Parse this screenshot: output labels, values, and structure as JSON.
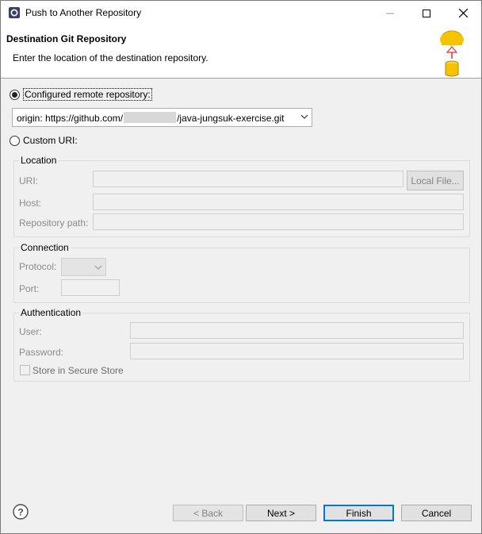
{
  "window": {
    "title": "Push to Another Repository"
  },
  "banner": {
    "title": "Destination Git Repository",
    "description": "Enter the location of the destination repository."
  },
  "configured": {
    "label": "Configured remote repository:",
    "selected": true,
    "combo_prefix": "origin: https://github.com/",
    "combo_suffix": "/java-jungsuk-exercise.git"
  },
  "custom": {
    "label": "Custom URI:",
    "selected": false
  },
  "location": {
    "title": "Location",
    "uri_label": "URI:",
    "host_label": "Host:",
    "path_label": "Repository path:",
    "local_file_button": "Local File..."
  },
  "connection": {
    "title": "Connection",
    "protocol_label": "Protocol:",
    "port_label": "Port:"
  },
  "authentication": {
    "title": "Authentication",
    "user_label": "User:",
    "password_label": "Password:",
    "store_label": "Store in Secure Store"
  },
  "buttons": {
    "back": "< Back",
    "next": "Next >",
    "finish": "Finish",
    "cancel": "Cancel"
  },
  "icons": {
    "app": "eclipse-icon",
    "minimize": "minimize-icon",
    "maximize": "maximize-icon",
    "close": "close-icon",
    "banner": "cloud-push-database-icon",
    "help": "help-icon",
    "dropdown": "chevron-down-icon"
  },
  "colors": {
    "accent": "#0078d7",
    "window_bg": "#f0f0f0",
    "cloud": "#f5c400",
    "arrow": "#e03030"
  }
}
